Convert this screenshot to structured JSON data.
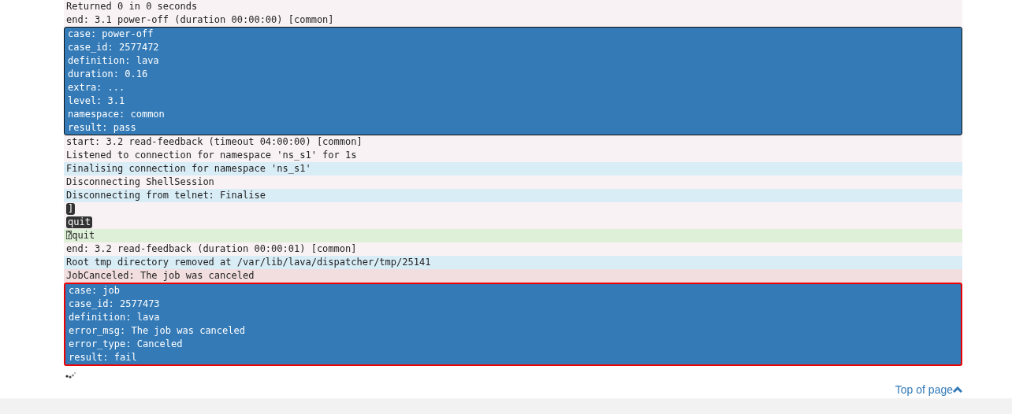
{
  "log": [
    {
      "kind": "info",
      "text": "Returned 0 in 0 seconds"
    },
    {
      "kind": "info",
      "text": "end: 3.1 power-off (duration 00:00:00) [common]"
    },
    {
      "kind": "results",
      "failed": false,
      "lines": [
        "case: power-off",
        "case_id: 2577472",
        "definition: lava",
        "duration: 0.16",
        "extra: ...",
        "level: 3.1",
        "namespace: common",
        "result: pass"
      ]
    },
    {
      "kind": "info",
      "text": "start: 3.2 read-feedback (timeout 04:00:00) [common]"
    },
    {
      "kind": "info",
      "text": "Listened to connection for namespace 'ns_s1' for 1s"
    },
    {
      "kind": "debug",
      "text": "Finalising connection for namespace 'ns_s1'"
    },
    {
      "kind": "info",
      "text": "Disconnecting ShellSession"
    },
    {
      "kind": "debug",
      "text": "Disconnecting from telnet: Finalise"
    },
    {
      "kind": "target",
      "text": "]"
    },
    {
      "kind": "target",
      "text": "quit"
    },
    {
      "kind": "input",
      "text": "⍰quit"
    },
    {
      "kind": "info",
      "text": "end: 3.2 read-feedback (duration 00:00:01) [common]"
    },
    {
      "kind": "debug",
      "text": "Root tmp directory removed at /var/lib/lava/dispatcher/tmp/25141"
    },
    {
      "kind": "error",
      "text": "JobCanceled: The job was canceled"
    },
    {
      "kind": "results",
      "failed": true,
      "lines": [
        "case: job",
        "case_id: 2577473",
        "definition: lava",
        "error_msg: The job was canceled",
        "error_type: Canceled",
        "result: fail"
      ]
    }
  ],
  "footer": {
    "link": "Top of page"
  }
}
